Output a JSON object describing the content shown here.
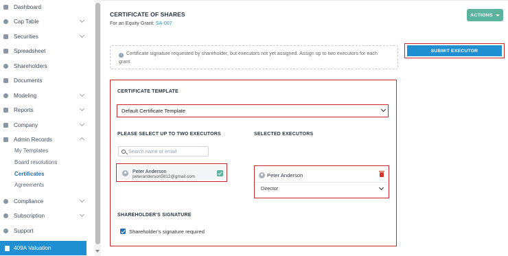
{
  "sidebar": {
    "items": [
      {
        "label": "Dashboard",
        "has_chevron": false
      },
      {
        "label": "Cap Table",
        "has_chevron": true
      },
      {
        "label": "Securities",
        "has_chevron": true
      },
      {
        "label": "Spreadsheet",
        "has_chevron": false
      },
      {
        "label": "Shareholders",
        "has_chevron": false
      },
      {
        "label": "Documents",
        "has_chevron": false
      },
      {
        "label": "Modeling",
        "has_chevron": true
      },
      {
        "label": "Reports",
        "has_chevron": true
      },
      {
        "label": "Company",
        "has_chevron": true
      },
      {
        "label": "Admin Records",
        "has_chevron": true,
        "expanded": true
      },
      {
        "label": "Compliance",
        "has_chevron": true
      },
      {
        "label": "Subscription",
        "has_chevron": true
      },
      {
        "label": "Support",
        "has_chevron": false
      }
    ],
    "sub_items": [
      {
        "label": "My Templates"
      },
      {
        "label": "Board resolutions"
      },
      {
        "label": "Certificates",
        "active": true
      },
      {
        "label": "Agreements"
      }
    ],
    "active_item": {
      "label": "409A Valuation"
    }
  },
  "header": {
    "title": "CERTIFICATE OF SHARES",
    "subtitle_prefix": "For an Equity Grant:",
    "grant_link": "SA-007",
    "actions_label": "ACTIONS"
  },
  "notice": {
    "text": "Certificate signature requested by shareholder, but executors not yet assigned. Assign up to two executors for each grant."
  },
  "submit_button": {
    "label": "SUBMIT EXECUTOR"
  },
  "form": {
    "template_label": "CERTIFICATE TEMPLATE",
    "template_value": "Default Certificate Template",
    "select_executors_label": "PLEASE SELECT UP TO TWO EXECUTORS",
    "selected_executors_label": "SELECTED EXECUTORS",
    "search_placeholder": "Search name or email",
    "candidates": [
      {
        "name": "Peter Anderson",
        "email": "peteranderson5812@gmail.com",
        "checked": true
      }
    ],
    "selected": [
      {
        "name": "Peter Anderson",
        "role": "Director"
      }
    ],
    "signature_label": "SHAREHOLDER'S SIGNATURE",
    "signature_checkbox_label": "Shareholder's signature required",
    "signature_required": true
  },
  "colors": {
    "accent": "#1f8fd1",
    "actions": "#5cb39e",
    "highlight_outline": "#c9262c",
    "danger": "#d9342b"
  }
}
